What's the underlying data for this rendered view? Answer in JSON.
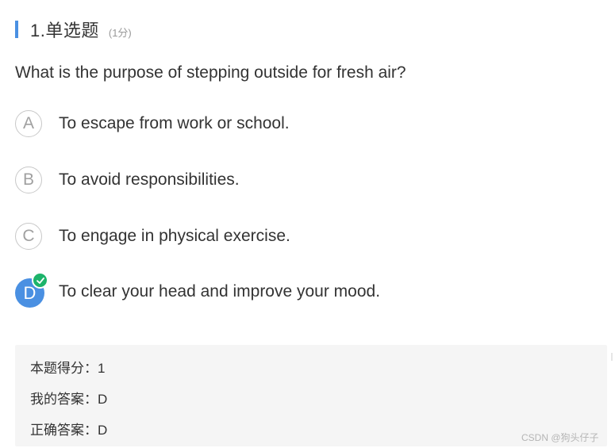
{
  "question": {
    "number_title": "1.单选题",
    "score_note": "(1分)",
    "text": "What is the purpose of stepping outside for fresh air?"
  },
  "options": [
    {
      "letter": "A",
      "text": "To escape from work or school.",
      "selected": false
    },
    {
      "letter": "B",
      "text": "To avoid responsibilities.",
      "selected": false
    },
    {
      "letter": "C",
      "text": "To engage in physical exercise.",
      "selected": false
    },
    {
      "letter": "D",
      "text": "To clear your head and improve your mood.",
      "selected": true
    }
  ],
  "result": {
    "score_line": "本题得分：1",
    "my_answer_line": "我的答案：D",
    "correct_answer_line": "正确答案：D"
  },
  "watermark": "CSDN @狗头仔子",
  "colors": {
    "accent": "#4a90e2",
    "correct": "#1db46b",
    "result_bg": "#f5f5f5"
  },
  "icons": {
    "correct_mark": "check-icon"
  }
}
